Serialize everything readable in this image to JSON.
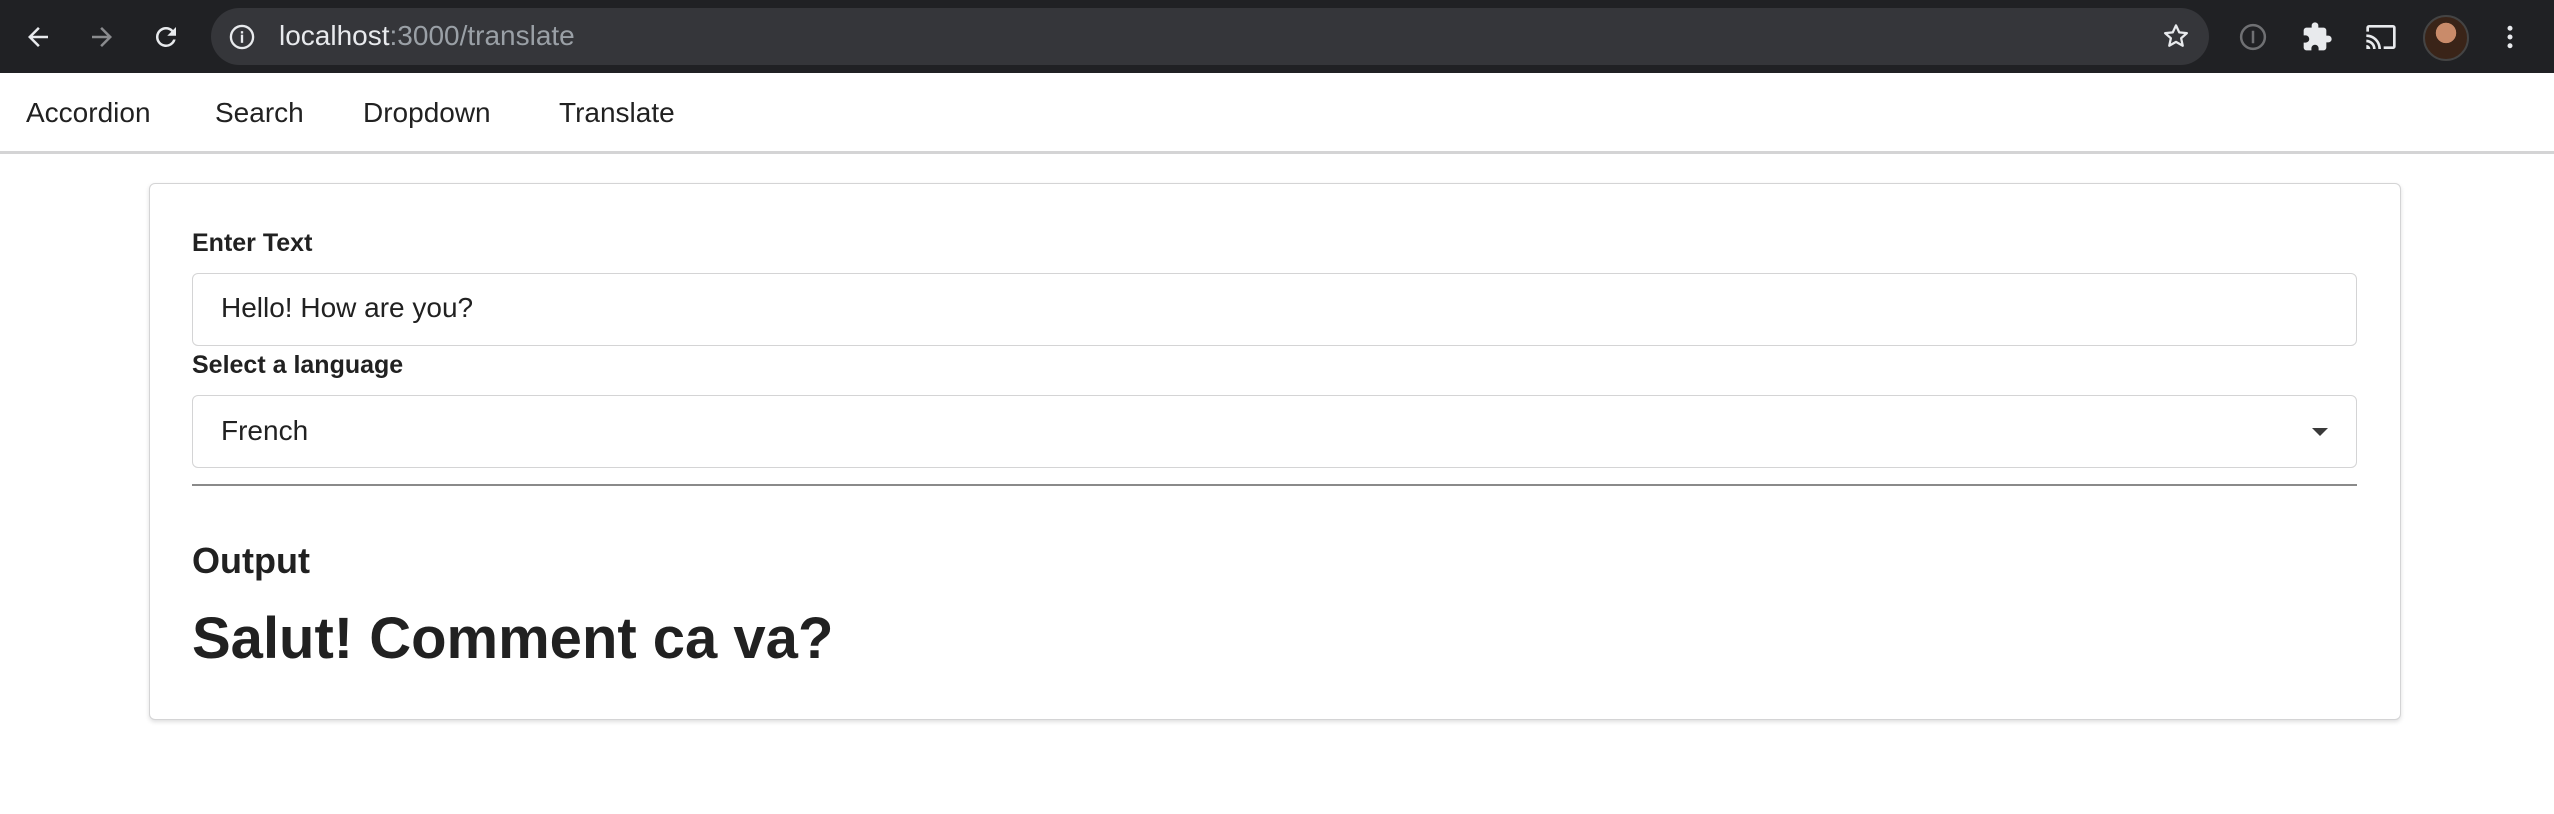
{
  "browser": {
    "url_host": "localhost",
    "url_rest": ":3000/translate"
  },
  "nav": {
    "items": [
      "Accordion",
      "Search",
      "Dropdown",
      "Translate"
    ]
  },
  "form": {
    "text_label": "Enter Text",
    "text_value": "Hello! How are you?",
    "language_label": "Select a language",
    "language_selected": "French"
  },
  "output": {
    "heading": "Output",
    "text": "Salut! Comment ca va?"
  }
}
